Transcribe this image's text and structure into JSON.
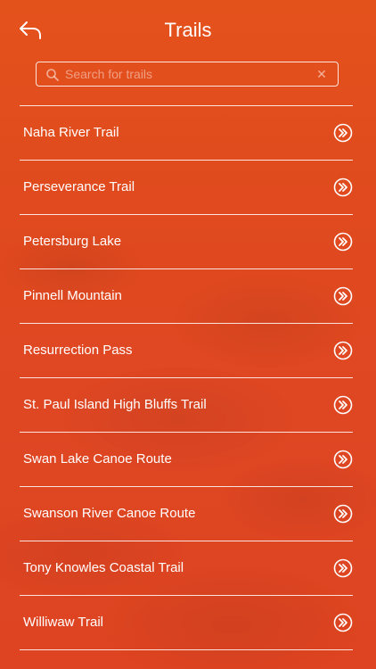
{
  "header": {
    "title": "Trails",
    "back_icon": "back-arrow-icon"
  },
  "search": {
    "placeholder": "Search for trails",
    "value": "",
    "search_icon": "search-icon",
    "clear_icon": "close-icon"
  },
  "trails": [
    {
      "label": "Naha River Trail"
    },
    {
      "label": "Perseverance Trail"
    },
    {
      "label": "Petersburg Lake"
    },
    {
      "label": "Pinnell Mountain"
    },
    {
      "label": "Resurrection Pass"
    },
    {
      "label": "St. Paul Island High Bluffs Trail"
    },
    {
      "label": "Swan Lake Canoe Route"
    },
    {
      "label": "Swanson River Canoe Route"
    },
    {
      "label": "Tony Knowles Coastal Trail"
    },
    {
      "label": "Williwaw Trail"
    }
  ],
  "colors": {
    "background": "#e04a1e",
    "foreground": "#ffffff"
  }
}
